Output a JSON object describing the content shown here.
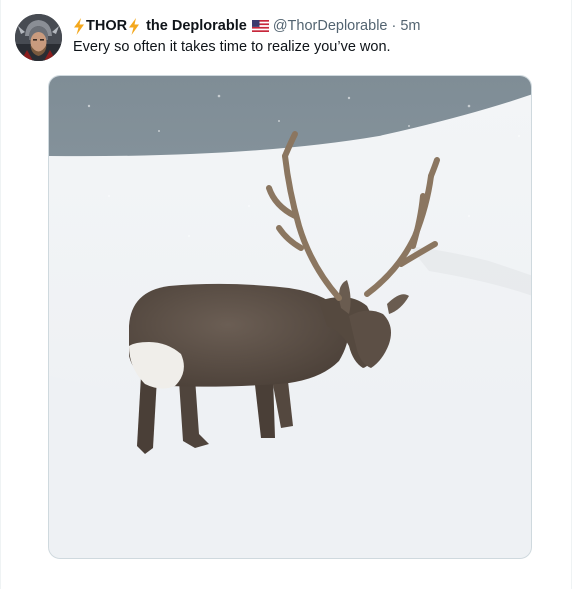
{
  "tweet": {
    "author": {
      "name_part_1": "THOR",
      "name_part_2": "the Deplorable",
      "handle": "@ThorDeplorable",
      "separator": "·",
      "timestamp": "5m",
      "avatar_icon": "thor-helmet-avatar",
      "emoji_icons": [
        "lightning-bolt-icon",
        "lightning-bolt-icon",
        "us-flag-icon"
      ]
    },
    "text": "Every so often it takes time to realize you’ve won.",
    "media": {
      "type": "photo",
      "subject_icon": "deer-in-snow-photo"
    }
  },
  "colors": {
    "text_primary": "#0f1419",
    "text_secondary": "#536471",
    "border": "#cfd9de",
    "bolt": "#f4a81d"
  }
}
